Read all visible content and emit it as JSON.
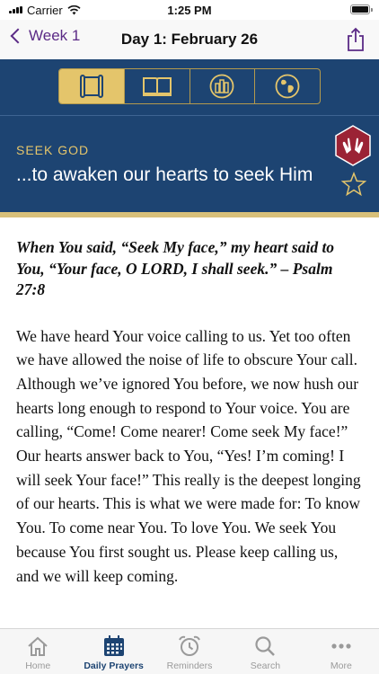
{
  "status_bar": {
    "carrier": "Carrier",
    "time": "1:25 PM",
    "battery_level": 1.0
  },
  "nav": {
    "back_label": "Week 1",
    "title": "Day 1: February 26"
  },
  "header": {
    "toolbar_items": [
      "scroll-icon",
      "book-icon",
      "city-icon",
      "globe-icon"
    ],
    "active_tool": 0,
    "category": "SEEK GOD",
    "headline": "...to awaken our hearts to seek Him",
    "colors": {
      "background": "#1d4472",
      "accent": "#e4c56b",
      "badge": "#9b2335",
      "stripe": "#d8c07a"
    }
  },
  "content": {
    "verse": "When You said, “Seek My face,” my heart said to You, “Your face, O LORD, I shall seek.”  – Psalm 27:8",
    "prayer": "We have heard Your voice calling to us. Yet too often we have allowed the noise of life to obscure Your call. Although we’ve ignored You before, we now hush our hearts long enough to respond to Your voice. You are calling, “Come! Come nearer! Come seek My face!” Our hearts answer back to You, “Yes! I’m coming! I will seek Your face!” This really is the deepest longing of our hearts. This is what we were made for: To know You. To come near You. To love You. We seek You because You first sought us. Please keep calling us, and we will keep coming."
  },
  "tabs": [
    {
      "label": "Home",
      "icon": "home-icon"
    },
    {
      "label": "Daily Prayers",
      "icon": "calendar-icon"
    },
    {
      "label": "Reminders",
      "icon": "alarm-clock-icon"
    },
    {
      "label": "Search",
      "icon": "search-icon"
    },
    {
      "label": "More",
      "icon": "more-icon"
    }
  ],
  "active_tab": 1
}
